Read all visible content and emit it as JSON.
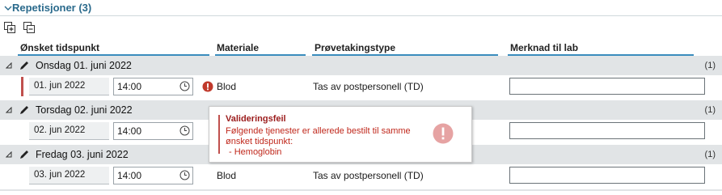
{
  "section": {
    "title": "Repetisjoner (3)"
  },
  "toolbar": {
    "expand_all": "expand-all",
    "collapse_all": "collapse-all"
  },
  "columns": {
    "onsket_tidspunkt": "Ønsket tidspunkt",
    "materiale": "Materiale",
    "provetakingstype": "Prøvetakingstype",
    "merknad": "Merknad til lab"
  },
  "groups": [
    {
      "label": "Onsdag 01. juni 2022",
      "count": "(1)",
      "row": {
        "date": "01. jun 2022",
        "time": "14:00",
        "materiale": "Blod",
        "provetakingstype": "Tas av postpersonell (TD)",
        "merknad": "",
        "has_error": true
      }
    },
    {
      "label": "Torsdag 02. juni 2022",
      "count": "(1)",
      "row": {
        "date": "02. jun 2022",
        "time": "14:00",
        "materiale": "",
        "provetakingstype": "",
        "merknad": ""
      }
    },
    {
      "label": "Fredag 03. juni 2022",
      "count": "(1)",
      "row": {
        "date": "03. jun 2022",
        "time": "14:00",
        "materiale": "Blod",
        "provetakingstype": "Tas av postpersonell (TD)",
        "merknad": ""
      }
    }
  ],
  "tooltip": {
    "title": "Valideringsfeil",
    "line1": "Følgende tjenester er allerede bestilt til samme",
    "line2": "ønsket tidspunkt:",
    "line3": "- Hemoglobin"
  },
  "colors": {
    "accent": "#3b8dbd",
    "group_bg": "#e1e4e6",
    "error": "#c0504d",
    "title": "#2a6a8c"
  },
  "icons": [
    "chevron-down-icon",
    "expand-all-icon",
    "collapse-all-icon",
    "collapse-triangle-icon",
    "pencil-icon",
    "clock-icon",
    "error-icon"
  ]
}
